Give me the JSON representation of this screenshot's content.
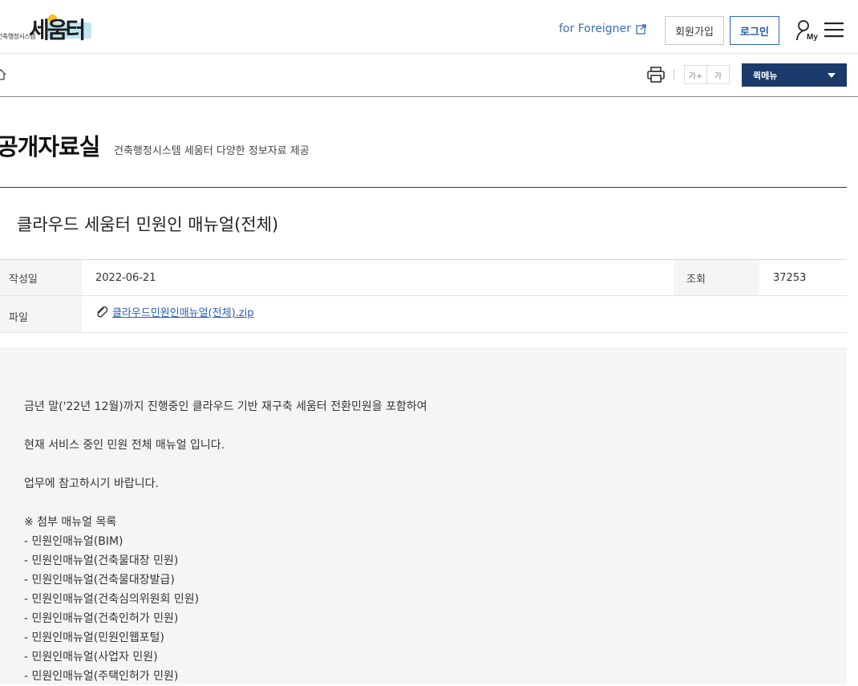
{
  "header": {
    "logo_sub": "건축행정시스템",
    "logo_main": "세움터",
    "foreigner_link": "for Foreigner",
    "join_button": "회원가입",
    "login_button": "로그인"
  },
  "toolbar": {
    "font_increase": "가+",
    "font_decrease": "가",
    "quick_menu": "퀵메뉴"
  },
  "page": {
    "title": "공개자료실",
    "description": "건축행정시스템 세움터 다양한 정보자료 제공"
  },
  "post": {
    "title": "클라우드 세움터 민원인 매뉴얼(전체)",
    "date_label": "작성일",
    "date": "2022-06-21",
    "views_label": "조회",
    "views": "37253",
    "file_label": "파일",
    "file_name": "클라우드민원인매뉴얼(전체).zip",
    "body": {
      "p1": "금년 말('22년 12월)까지 진행중인 클라우드 기반 재구축 세움터 전환민원을 포함하여",
      "p2": "현재 서비스 중인 민원 전체 매뉴얼 입니다.",
      "p3": "업무에 참고하시기 바랍니다.",
      "list_title": "※ 첨부 매뉴얼 목록",
      "items": [
        "- 민원인매뉴얼(BIM)",
        "- 민원인매뉴얼(건축물대장 민원)",
        "- 민원인매뉴얼(건축물대장발급)",
        "- 민원인매뉴얼(건축심의위원회 민원)",
        "- 민원인매뉴얼(건축인허가 민원)",
        "- 민원인매뉴얼(민원인웹포털)",
        "- 민원인매뉴얼(사업자 민원)",
        "- 민원인매뉴얼(주택인허가 민원)"
      ]
    }
  },
  "colors": {
    "quick_menu_bg": "#1b3a6b",
    "link": "#2a5db0",
    "login_border": "#2d6bb0"
  }
}
